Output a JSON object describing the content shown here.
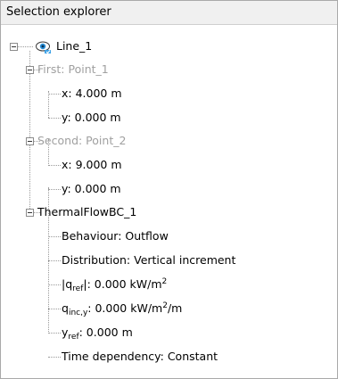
{
  "header": {
    "title": "Selection explorer"
  },
  "tree": {
    "root": {
      "label": "Line_1",
      "icon": "eye-icon"
    },
    "first": {
      "label": "First: Point_1",
      "x": "x: 4.000 m",
      "y": "y: 0.000 m"
    },
    "second": {
      "label": "Second: Point_2",
      "x": "x: 9.000 m",
      "y": "y: 0.000 m"
    },
    "bc": {
      "label": "ThermalFlowBC_1",
      "behaviour": "Behaviour: Outflow",
      "distribution": "Distribution: Vertical increment",
      "qref": {
        "sym": "|q",
        "sub": "ref",
        "tail": "|: 0.000 kW/m",
        "sup": "2"
      },
      "qinc": {
        "sym": "q",
        "sub": "inc,y",
        "tail": ": 0.000 kW/m",
        "sup": "2",
        "end": "/m"
      },
      "yref": {
        "sym": "y",
        "sub": "ref",
        "tail": ": 0.000 m"
      },
      "time": "Time dependency: Constant"
    }
  },
  "colors": {
    "muted_text": "#a0a0a0",
    "tree_lines": "#9a9a9a",
    "eye_accent": "#2a8fd6"
  }
}
